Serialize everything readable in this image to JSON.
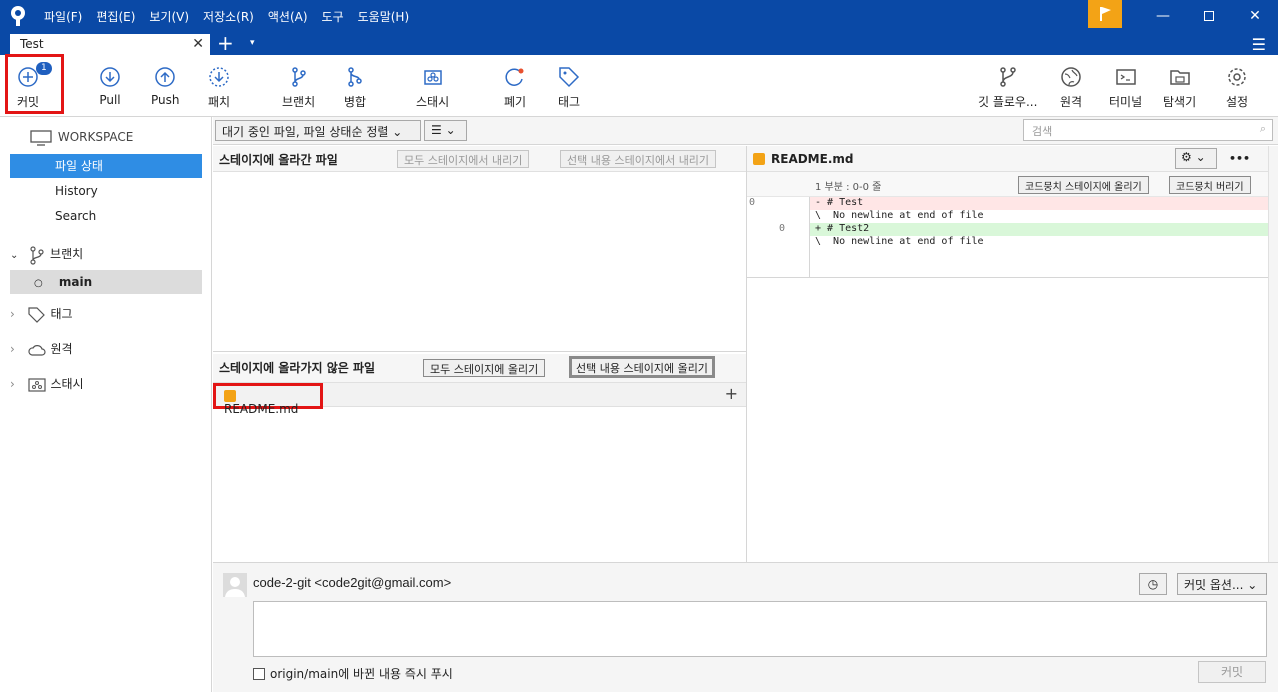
{
  "menu": [
    "파일(F)",
    "편집(E)",
    "보기(V)",
    "저장소(R)",
    "액션(A)",
    "도구",
    "도움말(H)"
  ],
  "tab": {
    "label": "Test",
    "close": "✕",
    "add": "+",
    "dropdown": "▾"
  },
  "toolbar": {
    "commit": "커밋",
    "commit_badge": "1",
    "pull": "Pull",
    "push": "Push",
    "patch": "패치",
    "branch": "브랜치",
    "merge": "병합",
    "stash": "스태시",
    "discard": "폐기",
    "tag": "태그",
    "gitflow": "깃 플로우...",
    "remote": "원격",
    "terminal": "터미널",
    "explorer": "탐색기",
    "settings": "설정"
  },
  "sidebar": {
    "workspace": "WORKSPACE",
    "file_status": "파일 상태",
    "history": "History",
    "search": "Search",
    "branches": "브랜치",
    "main": "main",
    "tags": "태그",
    "remotes": "원격",
    "stashes": "스태시"
  },
  "filter": {
    "sort": "대기 중인 파일, 파일 상태순 정렬",
    "view": "☰",
    "search_placeholder": "검색"
  },
  "staged": {
    "title": "스테이지에 올라간 파일",
    "unstage_all": "모두 스테이지에서 내리기",
    "unstage_sel": "선택 내용 스테이지에서 내리기"
  },
  "unstaged": {
    "title": "스테이지에 올라가지 않은 파일",
    "stage_all": "모두 스테이지에 올리기",
    "stage_sel": "선택 내용 스테이지에 올리기",
    "file": "README.md"
  },
  "diff": {
    "file": "README.md",
    "hunk": "1 부분 : 0-0 줄",
    "stage_hunk": "코드뭉치 스테이지에 올리기",
    "discard_hunk": "코드뭉치 버리기",
    "more": "•••",
    "lines": [
      {
        "old": "0",
        "new": "",
        "text": "- # Test",
        "kind": "del"
      },
      {
        "old": "",
        "new": "",
        "text": "\\  No newline at end of file",
        "kind": "ctx"
      },
      {
        "old": "",
        "new": "0",
        "text": "+ # Test2",
        "kind": "add"
      },
      {
        "old": "",
        "new": "",
        "text": "\\  No newline at end of file",
        "kind": "ctx"
      }
    ]
  },
  "commit_area": {
    "author": "code-2-git <code2git@gmail.com>",
    "options": "커밋 옵션...",
    "push_label": "origin/main에 바뀐 내용 즉시 푸시",
    "commit_btn": "커밋"
  },
  "colors": {
    "titlebar": "#0a49a6",
    "accent": "#2f8de4",
    "highlight": "#e31515",
    "flag": "#f3a316"
  }
}
